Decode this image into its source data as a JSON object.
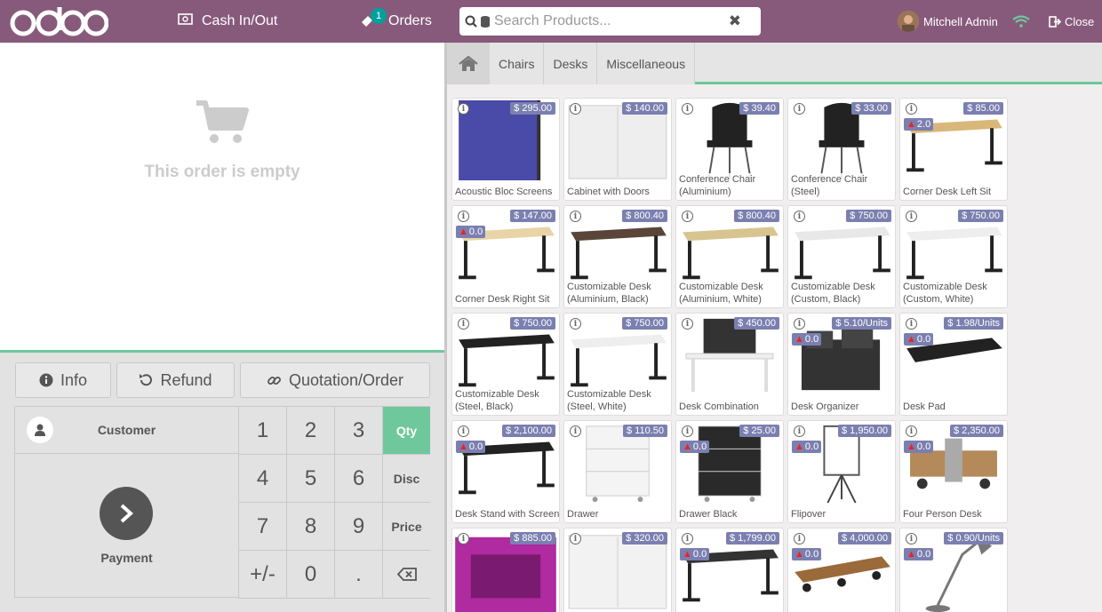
{
  "header": {
    "logo": "odoo",
    "cash_label": "Cash In/Out",
    "orders_label": "Orders",
    "orders_count": "1",
    "search_placeholder": "Search Products...",
    "user_name": "Mitchell Admin",
    "close_label": "Close"
  },
  "order": {
    "empty_message": "This order is empty"
  },
  "controls": {
    "info": "Info",
    "refund": "Refund",
    "quotation": "Quotation/Order"
  },
  "pad": {
    "customer": "Customer",
    "payment": "Payment",
    "keys": [
      "1",
      "2",
      "3",
      "Qty",
      "4",
      "5",
      "6",
      "Disc",
      "7",
      "8",
      "9",
      "Price",
      "+/-",
      "0",
      "."
    ]
  },
  "categories": [
    "Chairs",
    "Desks",
    "Miscellaneous"
  ],
  "products": [
    {
      "name": "Acoustic Bloc Screens",
      "price": "$ 295.00",
      "stock": "",
      "color": "#4a4aa8",
      "kind": "screen"
    },
    {
      "name": "Cabinet with Doors",
      "price": "$ 140.00",
      "stock": "",
      "color": "#eeeeee",
      "kind": "cabinet"
    },
    {
      "name": "Conference Chair (Aluminium)",
      "price": "$ 39.40",
      "stock": "",
      "color": "#222222",
      "kind": "chair"
    },
    {
      "name": "Conference Chair (Steel)",
      "price": "$ 33.00",
      "stock": "",
      "color": "#222222",
      "kind": "chair"
    },
    {
      "name": "Corner Desk Left Sit",
      "price": "$ 85.00",
      "stock": "2.0",
      "color": "#d9b77a",
      "kind": "desk"
    },
    {
      "name": "Corner Desk Right Sit",
      "price": "$ 147.00",
      "stock": "0.0",
      "color": "#e8d4a6",
      "kind": "desk"
    },
    {
      "name": "Customizable Desk (Aluminium, Black)",
      "price": "$ 800.40",
      "stock": "",
      "color": "#5a4638",
      "kind": "desk"
    },
    {
      "name": "Customizable Desk (Aluminium, White)",
      "price": "$ 800.40",
      "stock": "",
      "color": "#d8c48e",
      "kind": "desk"
    },
    {
      "name": "Customizable Desk (Custom, Black)",
      "price": "$ 750.00",
      "stock": "",
      "color": "#e8e8e8",
      "kind": "desk"
    },
    {
      "name": "Customizable Desk (Custom, White)",
      "price": "$ 750.00",
      "stock": "",
      "color": "#eeeeee",
      "kind": "desk"
    },
    {
      "name": "Customizable Desk (Steel, Black)",
      "price": "$ 750.00",
      "stock": "",
      "color": "#222222",
      "kind": "desk"
    },
    {
      "name": "Customizable Desk (Steel, White)",
      "price": "$ 750.00",
      "stock": "",
      "color": "#eeeeee",
      "kind": "desk"
    },
    {
      "name": "Desk Combination",
      "price": "$ 450.00",
      "stock": "",
      "color": "#333333",
      "kind": "combo"
    },
    {
      "name": "Desk Organizer",
      "price": "$ 5.10/Units",
      "stock": "0.0",
      "color": "#333333",
      "kind": "organizer"
    },
    {
      "name": "Desk Pad",
      "price": "$ 1.98/Units",
      "stock": "0.0",
      "color": "#222222",
      "kind": "pad"
    },
    {
      "name": "Desk Stand with Screen",
      "price": "$ 2,100.00",
      "stock": "0.0",
      "color": "#222222",
      "kind": "desk"
    },
    {
      "name": "Drawer",
      "price": "$ 110.50",
      "stock": "",
      "color": "#f4f4f4",
      "kind": "drawer"
    },
    {
      "name": "Drawer Black",
      "price": "$ 25.00",
      "stock": "0.0",
      "color": "#2a2a2a",
      "kind": "drawer"
    },
    {
      "name": "Flipover",
      "price": "$ 1,950.00",
      "stock": "0.0",
      "color": "#dddddd",
      "kind": "flip"
    },
    {
      "name": "Four Person Desk",
      "price": "$ 2,350.00",
      "stock": "0.0",
      "color": "#b58a5a",
      "kind": "four"
    },
    {
      "name": "",
      "price": "$ 885.00",
      "stock": "",
      "color": "#b02aa0",
      "kind": "booth"
    },
    {
      "name": "",
      "price": "$ 320.00",
      "stock": "",
      "color": "#f2f2f2",
      "kind": "cabinet"
    },
    {
      "name": "",
      "price": "$ 1,799.00",
      "stock": "0.0",
      "color": "#333333",
      "kind": "desk"
    },
    {
      "name": "",
      "price": "$ 4,000.00",
      "stock": "0.0",
      "color": "#9a6a3a",
      "kind": "table"
    },
    {
      "name": "",
      "price": "$ 0.90/Units",
      "stock": "0.0",
      "color": "#777777",
      "kind": "lamp"
    }
  ],
  "colors": {
    "header": "#875a7b",
    "accent": "#6ec89b",
    "price_tag": "#7b7fb0"
  }
}
